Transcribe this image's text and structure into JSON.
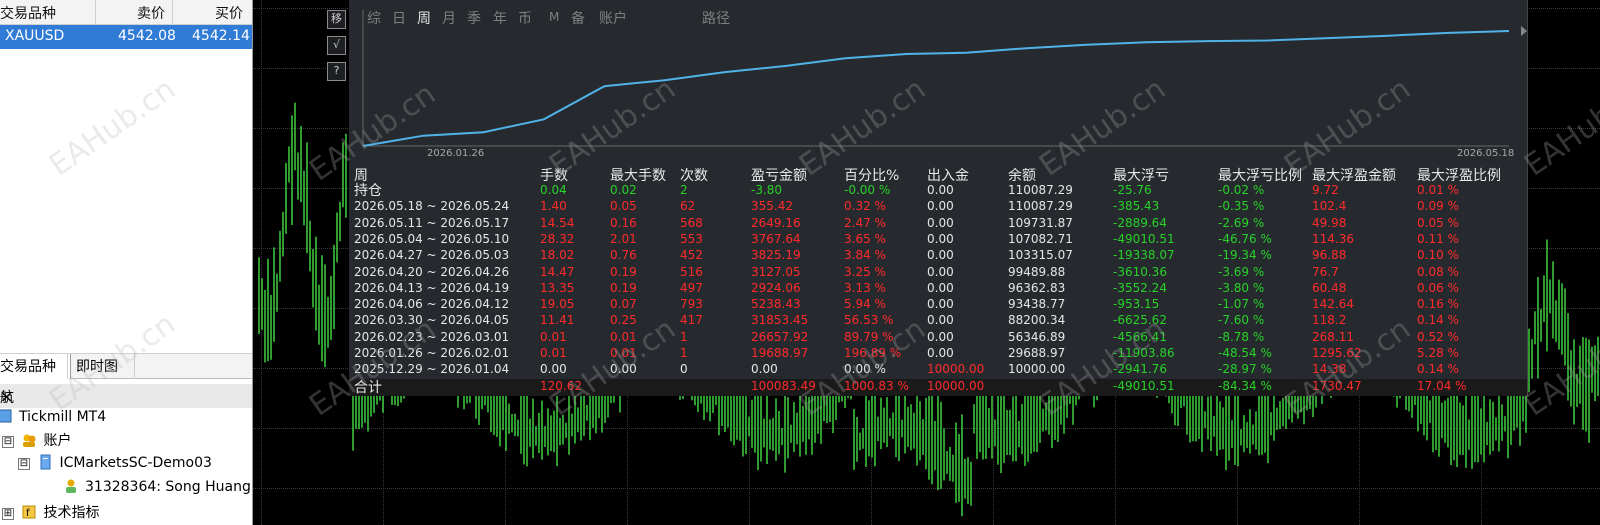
{
  "market_watch": {
    "columns": [
      "交易品种",
      "卖价",
      "买价"
    ],
    "rows": [
      {
        "symbol": "XAUUSD",
        "bid": "4542.08",
        "ask": "4542.14"
      }
    ]
  },
  "left_tabs": [
    "交易品种",
    "即时图"
  ],
  "navigator": {
    "title": "航",
    "close": "×",
    "items": [
      {
        "label": "Tickmill MT4",
        "icon": "terminal-icon"
      },
      {
        "label": "账户",
        "icon": "accounts-icon",
        "expander": "⊟"
      },
      {
        "label": "ICMarketsSC-Demo03",
        "icon": "server-icon",
        "expander": "⊟"
      },
      {
        "label": "31328364: Song Huang",
        "icon": "user-account-icon"
      },
      {
        "label": "技术指标",
        "icon": "indicator-icon",
        "expander": "⊞"
      }
    ]
  },
  "panel": {
    "side_buttons": [
      "移",
      "√",
      "?"
    ],
    "menu": [
      "综",
      "日",
      "周",
      "月",
      "季",
      "年",
      "币",
      "M",
      "备",
      "账户",
      "路径"
    ],
    "active_menu": "周",
    "graph": {
      "start_date": "2026.01.26",
      "end_date": "2026.05.18",
      "points": [
        0,
        4.8,
        6.4,
        12.4,
        27.8,
        30.6,
        34.4,
        37.2,
        40.8,
        42.8,
        43.4,
        45.5,
        47.1,
        48.3,
        48.8,
        49.1,
        50.2,
        51.3,
        52.6,
        53.5
      ]
    },
    "headers": [
      "周",
      "手数",
      "最大手数",
      "次数",
      "盈亏金额",
      "百分比%",
      "出入金",
      "余额",
      "最大浮亏",
      "最大浮亏比例",
      "最大浮盈金额",
      "最大浮盈比例"
    ],
    "rows": [
      [
        "持仓",
        "0.04",
        "0.02",
        "2",
        "-3.80",
        "-0.00 %",
        "0.00",
        "110087.29",
        "-25.76",
        "-0.02 %",
        "9.72",
        "0.01 %"
      ],
      [
        "2026.05.18 ~ 2026.05.24",
        "1.40",
        "0.05",
        "62",
        "355.42",
        "0.32 %",
        "0.00",
        "110087.29",
        "-385.43",
        "-0.35 %",
        "102.4",
        "0.09 %"
      ],
      [
        "2026.05.11 ~ 2026.05.17",
        "14.54",
        "0.16",
        "568",
        "2649.16",
        "2.47 %",
        "0.00",
        "109731.87",
        "-2889.64",
        "-2.69 %",
        "49.98",
        "0.05 %"
      ],
      [
        "2026.05.04 ~ 2026.05.10",
        "28.32",
        "2.01",
        "553",
        "3767.64",
        "3.65 %",
        "0.00",
        "107082.71",
        "-49010.51",
        "-46.76 %",
        "114.36",
        "0.11 %"
      ],
      [
        "2026.04.27 ~ 2026.05.03",
        "18.02",
        "0.76",
        "452",
        "3825.19",
        "3.84 %",
        "0.00",
        "103315.07",
        "-19338.07",
        "-19.34 %",
        "96.88",
        "0.10 %"
      ],
      [
        "2026.04.20 ~ 2026.04.26",
        "14.47",
        "0.19",
        "516",
        "3127.05",
        "3.25 %",
        "0.00",
        "99489.88",
        "-3610.36",
        "-3.69 %",
        "76.7",
        "0.08 %"
      ],
      [
        "2026.04.13 ~ 2026.04.19",
        "13.35",
        "0.19",
        "497",
        "2924.06",
        "3.13 %",
        "0.00",
        "96362.83",
        "-3552.24",
        "-3.80 %",
        "60.48",
        "0.06 %"
      ],
      [
        "2026.04.06 ~ 2026.04.12",
        "19.05",
        "0.07",
        "793",
        "5238.43",
        "5.94 %",
        "0.00",
        "93438.77",
        "-953.15",
        "-1.07 %",
        "142.64",
        "0.16 %"
      ],
      [
        "2026.03.30 ~ 2026.04.05",
        "11.41",
        "0.25",
        "417",
        "31853.45",
        "56.53 %",
        "0.00",
        "88200.34",
        "-6625.62",
        "-7.60 %",
        "118.2",
        "0.14 %"
      ],
      [
        "2026.02.23 ~ 2026.03.01",
        "0.01",
        "0.01",
        "1",
        "26657.92",
        "89.79 %",
        "0.00",
        "56346.89",
        "-4566.41",
        "-8.78 %",
        "268.11",
        "0.52 %"
      ],
      [
        "2026.01.26 ~ 2026.02.01",
        "0.01",
        "0.01",
        "1",
        "19688.97",
        "196.89 %",
        "0.00",
        "29688.97",
        "-11903.86",
        "-48.54 %",
        "1295.62",
        "5.28 %"
      ],
      [
        "2025.12.29 ~ 2026.01.04",
        "0.00",
        "0.00",
        "0",
        "0.00",
        "0.00 %",
        "10000.00",
        "10000.00",
        "-2941.76",
        "-28.97 %",
        "14.38",
        "0.14 %"
      ]
    ],
    "total": [
      "合计",
      "120.62",
      "",
      "",
      "100083.49",
      "1000.83 %",
      "10000.00",
      "",
      "-49010.51",
      "-84.34 %",
      "1730.47",
      "17.04 %"
    ]
  },
  "watermark": "EAHub.cn",
  "colors": {
    "positive": "#27d127",
    "negative": "#ff2a2a",
    "equity_line": "#4fb3e8",
    "selected_row": "#2f7bd6",
    "candles": "#3fd13f"
  }
}
